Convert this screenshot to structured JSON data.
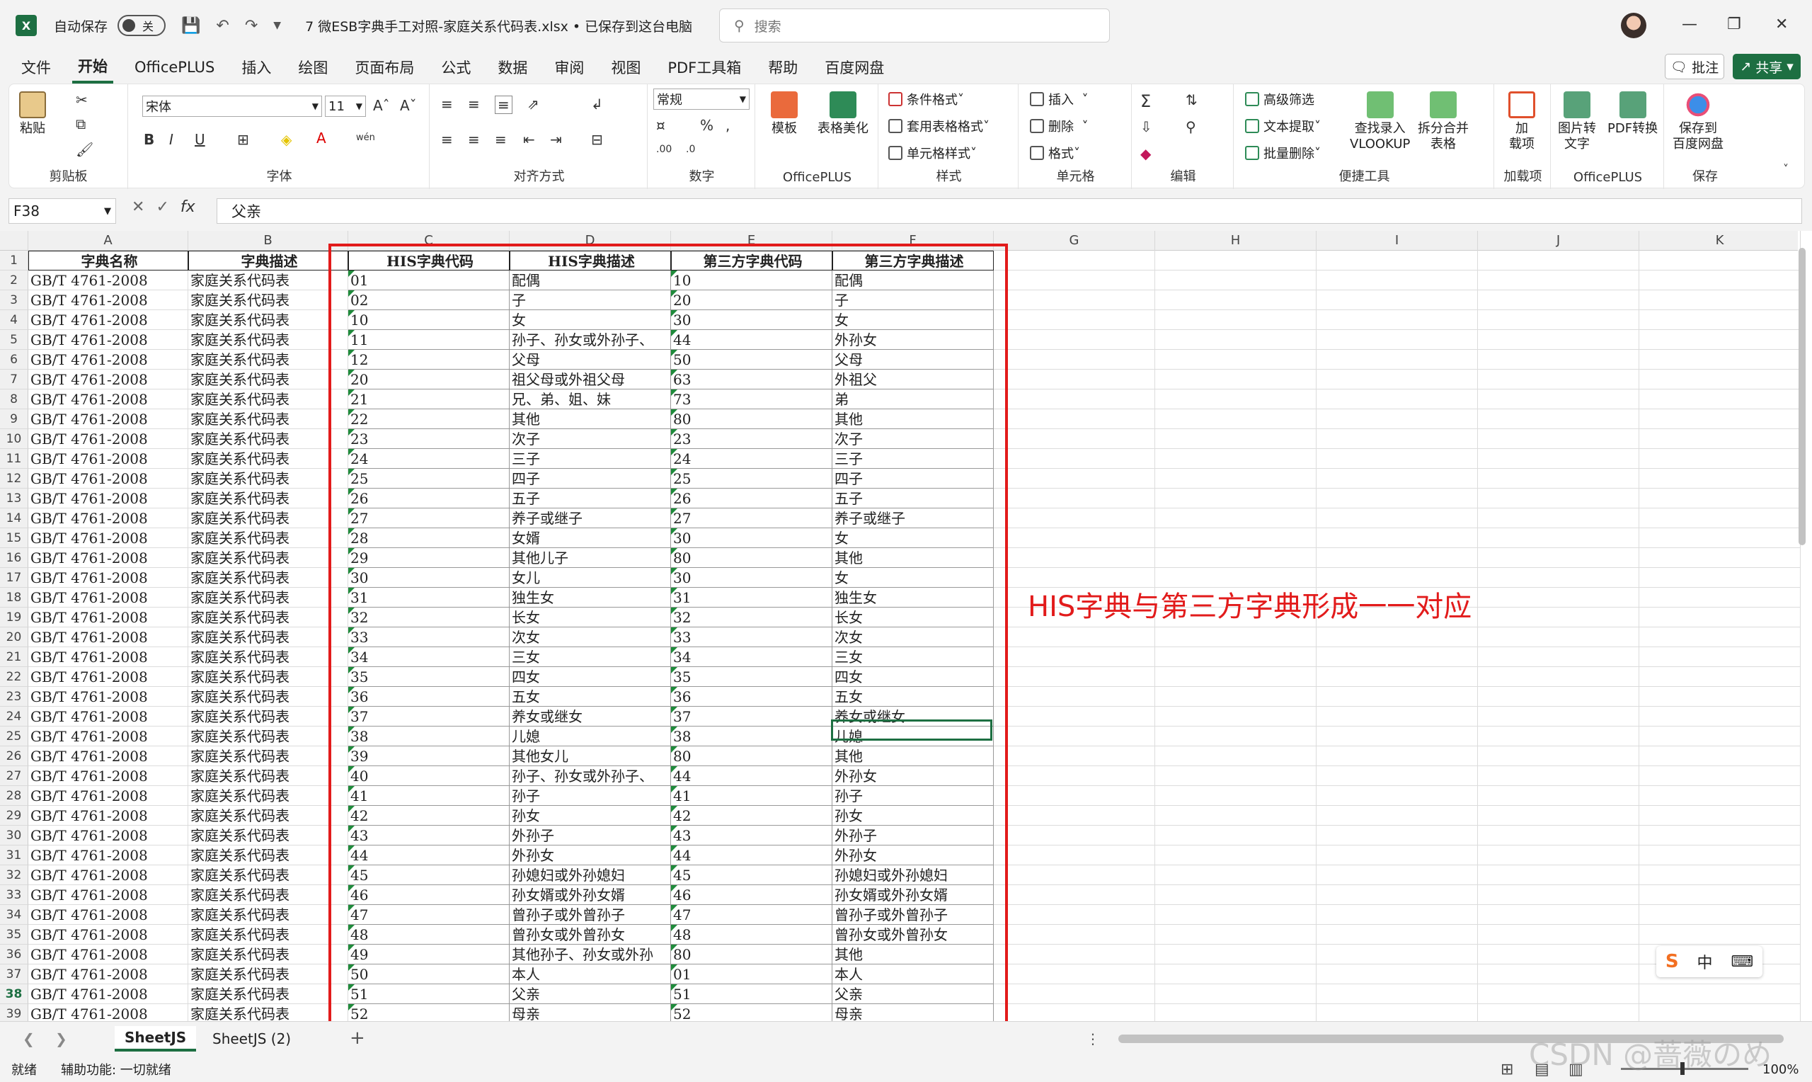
{
  "app": {
    "autosave_label": "自动保存",
    "autosave_state": "关",
    "title": "7 微ESB字典手工对照-家庭关系代码表.xlsx • 已保存到这台电脑",
    "search_placeholder": "搜索"
  },
  "menu": [
    "文件",
    "开始",
    "OfficePLUS",
    "插入",
    "绘图",
    "页面布局",
    "公式",
    "数据",
    "审阅",
    "视图",
    "PDF工具箱",
    "帮助",
    "百度网盘"
  ],
  "menu_active": "开始",
  "buttons": {
    "comment": "批注",
    "share": "共享"
  },
  "ribbon": {
    "clipboard": {
      "label": "剪贴板",
      "paste": "粘贴"
    },
    "font": {
      "label": "字体",
      "name": "宋体",
      "size": "11"
    },
    "alignment": {
      "label": "对齐方式"
    },
    "number": {
      "label": "数字",
      "format": "常规"
    },
    "officeplus": {
      "label": "OfficePLUS",
      "template": "模板",
      "beautify": "表格美化"
    },
    "styles": {
      "label": "样式",
      "conditional": "条件格式",
      "table_format": "套用表格格式",
      "cell_style": "单元格样式"
    },
    "cells": {
      "label": "单元格",
      "insert": "插入",
      "delete": "删除",
      "format": "格式"
    },
    "editing": {
      "label": "编辑"
    },
    "quick_tools": {
      "label": "便捷工具",
      "advanced_filter": "高级筛选",
      "text_extract": "文本提取",
      "batch_delete": "批量删除",
      "vlookup_1": "查找录入",
      "vlookup_2": "VLOOKUP",
      "split_merge_1": "拆分合并",
      "split_merge_2": "表格"
    },
    "addins": {
      "label": "加载项",
      "btn_1": "加",
      "btn_2": "载项"
    },
    "officeplus2": {
      "label": "OfficePLUS",
      "img2text_1": "图片转",
      "img2text_2": "文字",
      "pdf_1": "PDF转换"
    },
    "save": {
      "label": "保存",
      "btn_1": "保存到",
      "btn_2": "百度网盘"
    }
  },
  "formula_bar": {
    "name_box": "F38",
    "fx": "fx",
    "value": "父亲"
  },
  "columns": [
    "A",
    "B",
    "C",
    "D",
    "E",
    "F",
    "G",
    "H",
    "I",
    "J",
    "K"
  ],
  "table": {
    "headers": [
      "字典名称",
      "字典描述",
      "HIS字典代码",
      "HIS字典描述",
      "第三方字典代码",
      "第三方字典描述"
    ],
    "rows": [
      [
        "GB/T 4761-2008",
        "家庭关系代码表",
        "01",
        "配偶",
        "10",
        "配偶"
      ],
      [
        "GB/T 4761-2008",
        "家庭关系代码表",
        "02",
        "子",
        "20",
        "子"
      ],
      [
        "GB/T 4761-2008",
        "家庭关系代码表",
        "10",
        "女",
        "30",
        "女"
      ],
      [
        "GB/T 4761-2008",
        "家庭关系代码表",
        "11",
        "孙子、孙女或外孙子、",
        "44",
        "外孙女"
      ],
      [
        "GB/T 4761-2008",
        "家庭关系代码表",
        "12",
        "父母",
        "50",
        "父母"
      ],
      [
        "GB/T 4761-2008",
        "家庭关系代码表",
        "20",
        "祖父母或外祖父母",
        "63",
        "外祖父"
      ],
      [
        "GB/T 4761-2008",
        "家庭关系代码表",
        "21",
        "兄、弟、姐、妹",
        "73",
        "弟"
      ],
      [
        "GB/T 4761-2008",
        "家庭关系代码表",
        "22",
        "其他",
        "80",
        "其他"
      ],
      [
        "GB/T 4761-2008",
        "家庭关系代码表",
        "23",
        "次子",
        "23",
        "次子"
      ],
      [
        "GB/T 4761-2008",
        "家庭关系代码表",
        "24",
        "三子",
        "24",
        "三子"
      ],
      [
        "GB/T 4761-2008",
        "家庭关系代码表",
        "25",
        "四子",
        "25",
        "四子"
      ],
      [
        "GB/T 4761-2008",
        "家庭关系代码表",
        "26",
        "五子",
        "26",
        "五子"
      ],
      [
        "GB/T 4761-2008",
        "家庭关系代码表",
        "27",
        "养子或继子",
        "27",
        "养子或继子"
      ],
      [
        "GB/T 4761-2008",
        "家庭关系代码表",
        "28",
        "女婿",
        "30",
        "女"
      ],
      [
        "GB/T 4761-2008",
        "家庭关系代码表",
        "29",
        "其他儿子",
        "80",
        "其他"
      ],
      [
        "GB/T 4761-2008",
        "家庭关系代码表",
        "30",
        "女儿",
        "30",
        "女"
      ],
      [
        "GB/T 4761-2008",
        "家庭关系代码表",
        "31",
        "独生女",
        "31",
        "独生女"
      ],
      [
        "GB/T 4761-2008",
        "家庭关系代码表",
        "32",
        "长女",
        "32",
        "长女"
      ],
      [
        "GB/T 4761-2008",
        "家庭关系代码表",
        "33",
        "次女",
        "33",
        "次女"
      ],
      [
        "GB/T 4761-2008",
        "家庭关系代码表",
        "34",
        "三女",
        "34",
        "三女"
      ],
      [
        "GB/T 4761-2008",
        "家庭关系代码表",
        "35",
        "四女",
        "35",
        "四女"
      ],
      [
        "GB/T 4761-2008",
        "家庭关系代码表",
        "36",
        "五女",
        "36",
        "五女"
      ],
      [
        "GB/T 4761-2008",
        "家庭关系代码表",
        "37",
        "养女或继女",
        "37",
        "养女或继女"
      ],
      [
        "GB/T 4761-2008",
        "家庭关系代码表",
        "38",
        "儿媳",
        "38",
        "儿媳"
      ],
      [
        "GB/T 4761-2008",
        "家庭关系代码表",
        "39",
        "其他女儿",
        "80",
        "其他"
      ],
      [
        "GB/T 4761-2008",
        "家庭关系代码表",
        "40",
        "孙子、孙女或外孙子、",
        "44",
        "外孙女"
      ],
      [
        "GB/T 4761-2008",
        "家庭关系代码表",
        "41",
        "孙子",
        "41",
        "孙子"
      ],
      [
        "GB/T 4761-2008",
        "家庭关系代码表",
        "42",
        "孙女",
        "42",
        "孙女"
      ],
      [
        "GB/T 4761-2008",
        "家庭关系代码表",
        "43",
        "外孙子",
        "43",
        "外孙子"
      ],
      [
        "GB/T 4761-2008",
        "家庭关系代码表",
        "44",
        "外孙女",
        "44",
        "外孙女"
      ],
      [
        "GB/T 4761-2008",
        "家庭关系代码表",
        "45",
        "孙媳妇或外孙媳妇",
        "45",
        "孙媳妇或外孙媳妇"
      ],
      [
        "GB/T 4761-2008",
        "家庭关系代码表",
        "46",
        "孙女婿或外孙女婿",
        "46",
        "孙女婿或外孙女婿"
      ],
      [
        "GB/T 4761-2008",
        "家庭关系代码表",
        "47",
        "曾孙子或外曾孙子",
        "47",
        "曾孙子或外曾孙子"
      ],
      [
        "GB/T 4761-2008",
        "家庭关系代码表",
        "48",
        "曾孙女或外曾孙女",
        "48",
        "曾孙女或外曾孙女"
      ],
      [
        "GB/T 4761-2008",
        "家庭关系代码表",
        "49",
        "其他孙子、孙女或外孙",
        "80",
        "其他"
      ],
      [
        "GB/T 4761-2008",
        "家庭关系代码表",
        "50",
        "本人",
        "01",
        "本人"
      ],
      [
        "GB/T 4761-2008",
        "家庭关系代码表",
        "51",
        "父亲",
        "51",
        "父亲"
      ],
      [
        "GB/T 4761-2008",
        "家庭关系代码表",
        "52",
        "母亲",
        "52",
        "母亲"
      ]
    ]
  },
  "annotation": "HIS字典与第三方字典形成一一对应",
  "sheets": [
    "SheetJS",
    "SheetJS (2)"
  ],
  "active_sheet": "SheetJS",
  "status": {
    "ready": "就绪",
    "accessibility": "辅助功能: 一切就绪",
    "zoom": "100%"
  },
  "ime": {
    "lang": "中"
  },
  "watermark": "CSDN @蔷薇のめ",
  "colors": {
    "excel_green": "#1d6f42",
    "annotation_red": "#e21b1b",
    "text_flag": "#1f8b3b"
  }
}
